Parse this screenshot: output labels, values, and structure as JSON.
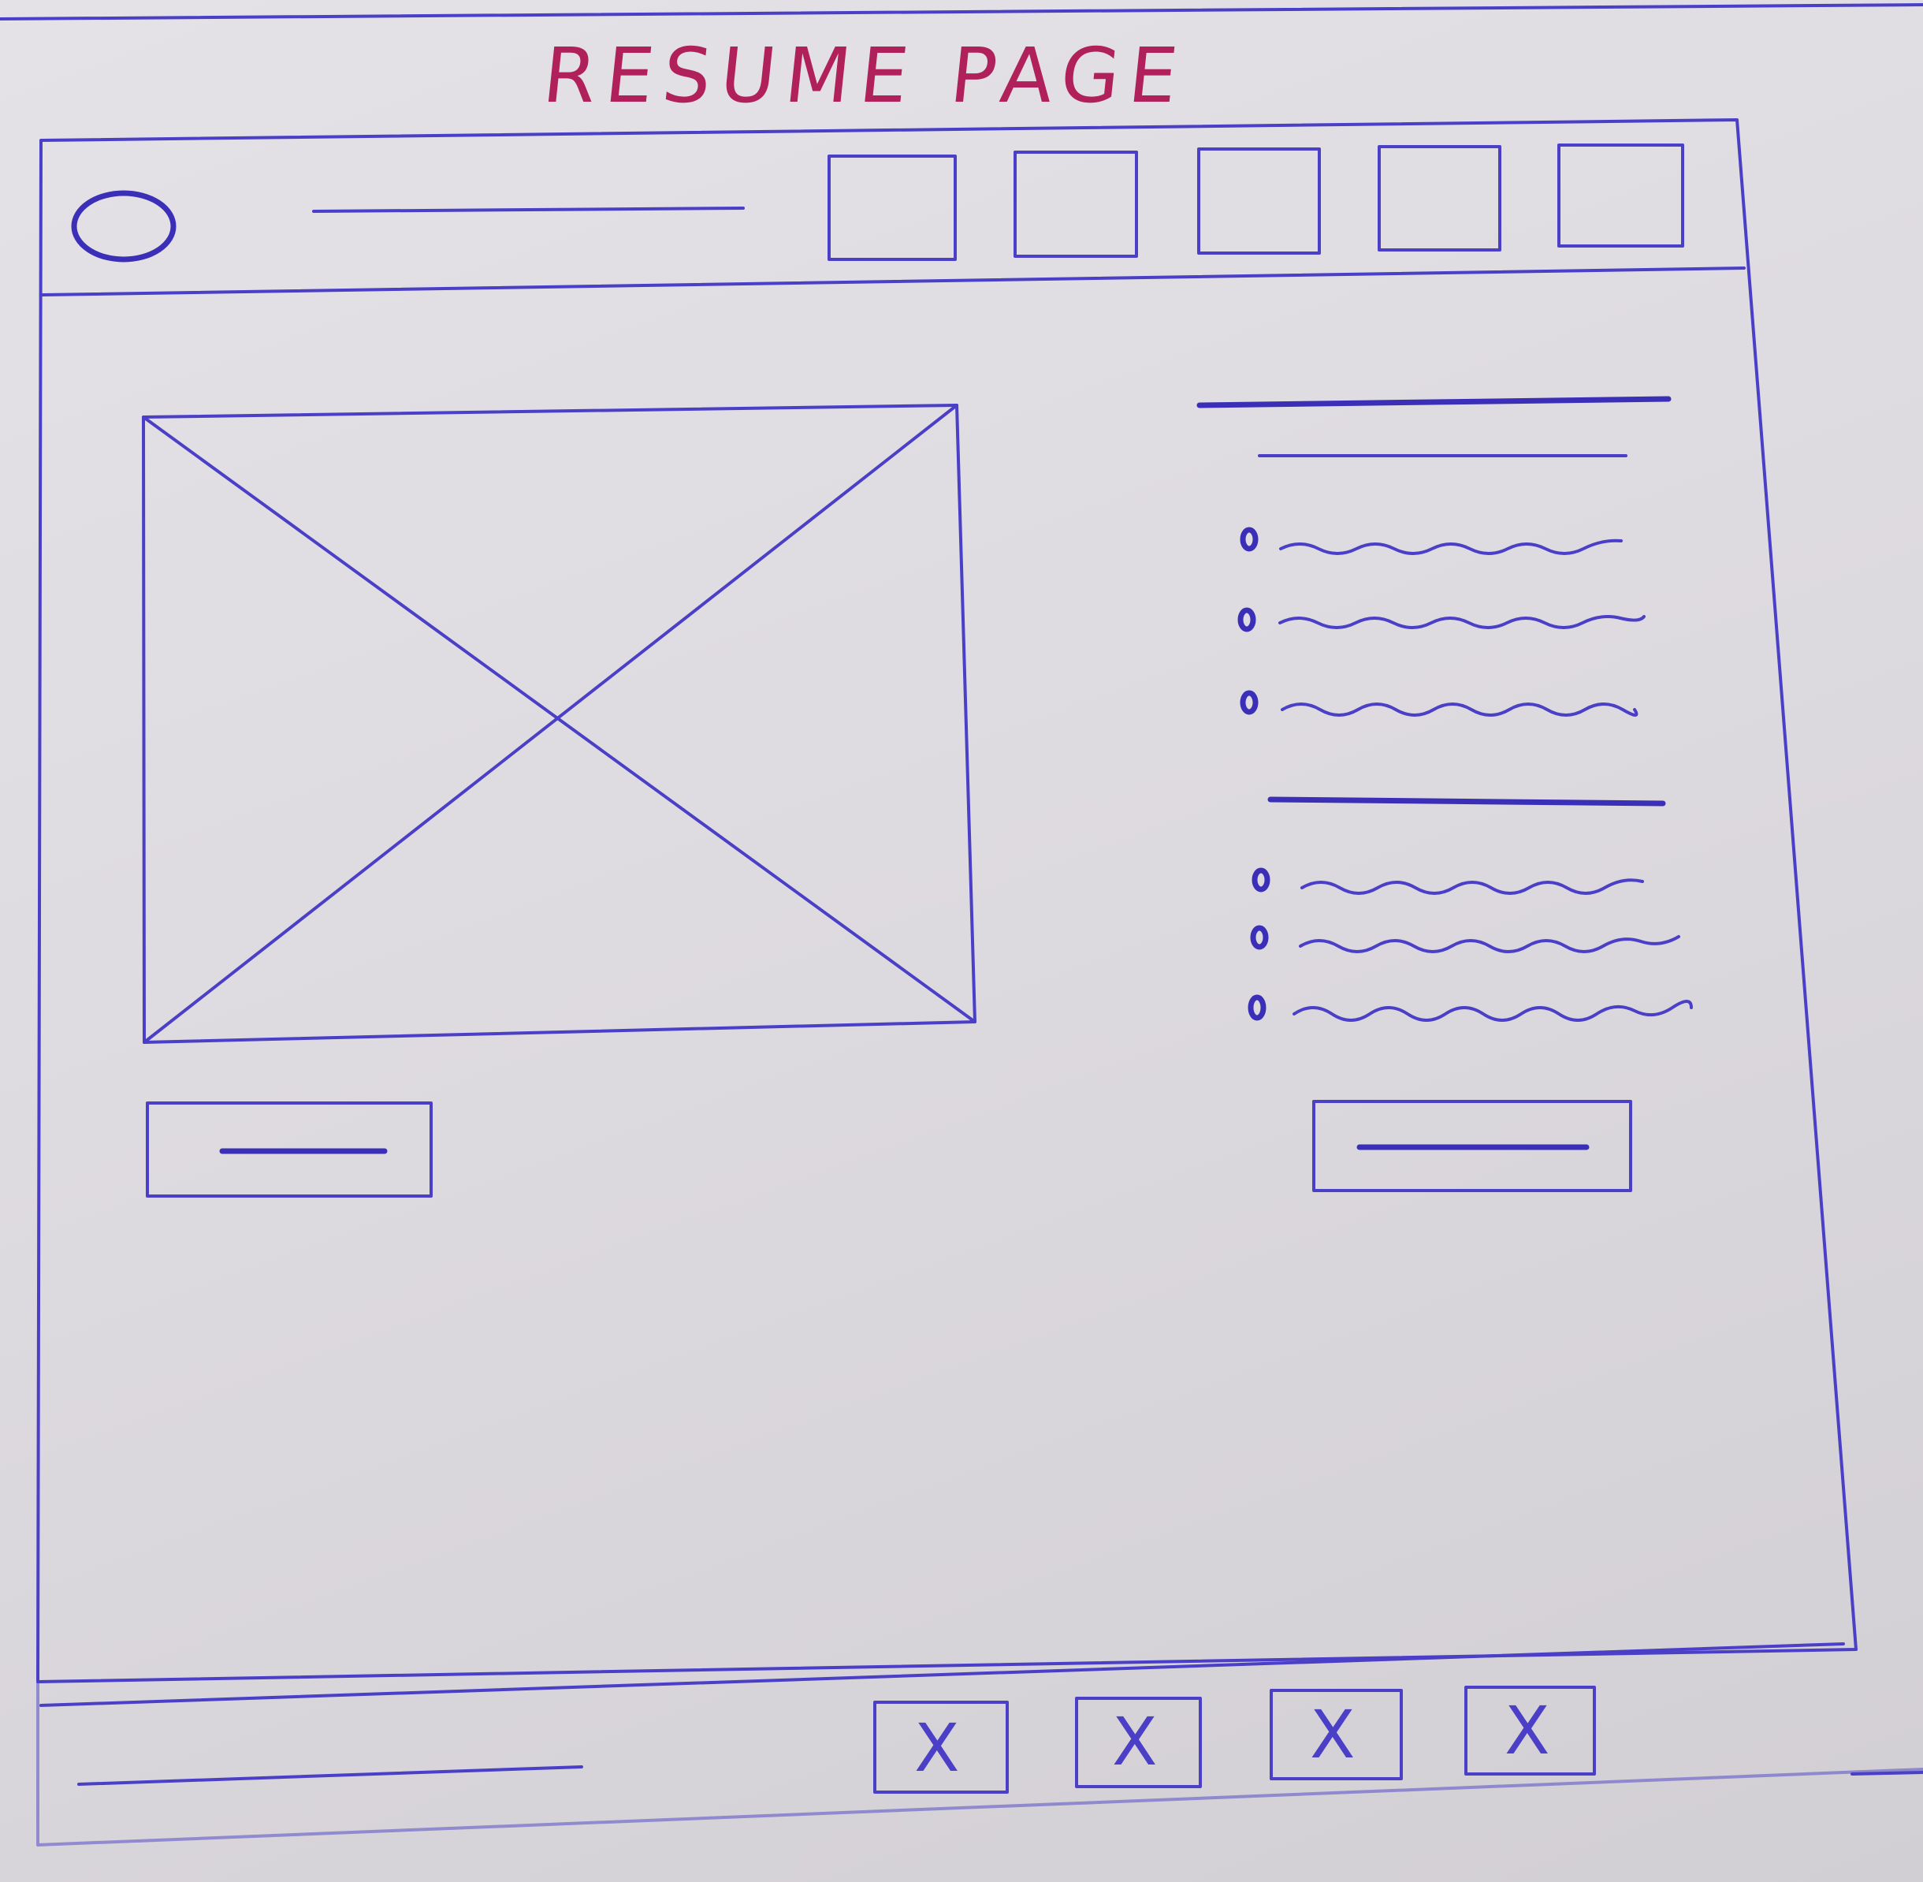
{
  "page": {
    "title": "RESUME PAGE"
  },
  "header": {
    "logo_icon": "logo-circle-icon",
    "nav_box_count": 5
  },
  "main": {
    "image_placeholder_icon": "image-placeholder-icon",
    "list_groups": [
      {
        "items": 3
      },
      {
        "items": 3
      }
    ]
  },
  "footer": {
    "social_icons": [
      {
        "icon": "close-icon",
        "label": "X"
      },
      {
        "icon": "close-icon",
        "label": "X"
      },
      {
        "icon": "close-icon",
        "label": "X"
      },
      {
        "icon": "close-icon",
        "label": "X"
      }
    ]
  },
  "colors": {
    "ink": "#4a3fc6",
    "title_ink": "#b0205a",
    "paper": "#e0dde2"
  }
}
